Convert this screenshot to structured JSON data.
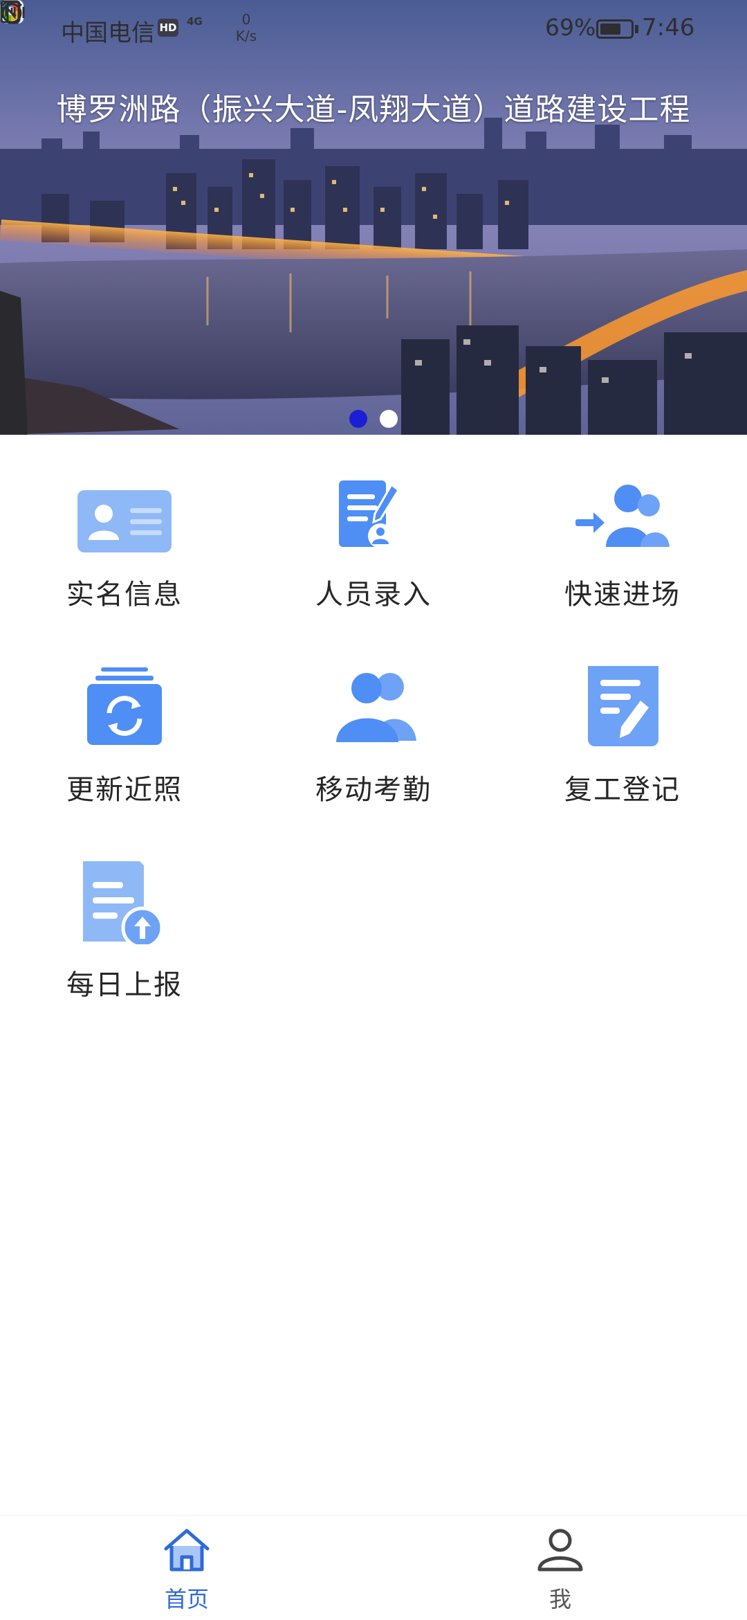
{
  "status_bar": {
    "carrier": "中国电信",
    "hd_badge": "HD",
    "network": "4G",
    "speed_value": "0",
    "speed_unit": "K/s",
    "battery_percent": "69%",
    "battery_level": 0.69,
    "time": "7:46"
  },
  "banner": {
    "title": "博罗洲路（振兴大道-凤翔大道）道路建设工程",
    "slide_count": 2,
    "active_slide": 1
  },
  "features": [
    {
      "label": "实名信息",
      "icon": "id-card-icon"
    },
    {
      "label": "人员录入",
      "icon": "document-edit-user-icon"
    },
    {
      "label": "快速进场",
      "icon": "users-enter-icon"
    },
    {
      "label": "更新近照",
      "icon": "photo-refresh-icon"
    },
    {
      "label": "移动考勤",
      "icon": "users-group-icon"
    },
    {
      "label": "复工登记",
      "icon": "note-edit-icon"
    },
    {
      "label": "每日上报",
      "icon": "file-upload-icon"
    }
  ],
  "bottom_nav": {
    "home_label": "首页",
    "me_label": "我",
    "active": "home"
  },
  "colors": {
    "icon_blue": "#4e8ef5",
    "icon_light_blue": "#8fb8f7",
    "nav_active": "#2f6ad9",
    "nav_inactive": "#555555",
    "dot_active": "#1a1fd6"
  }
}
